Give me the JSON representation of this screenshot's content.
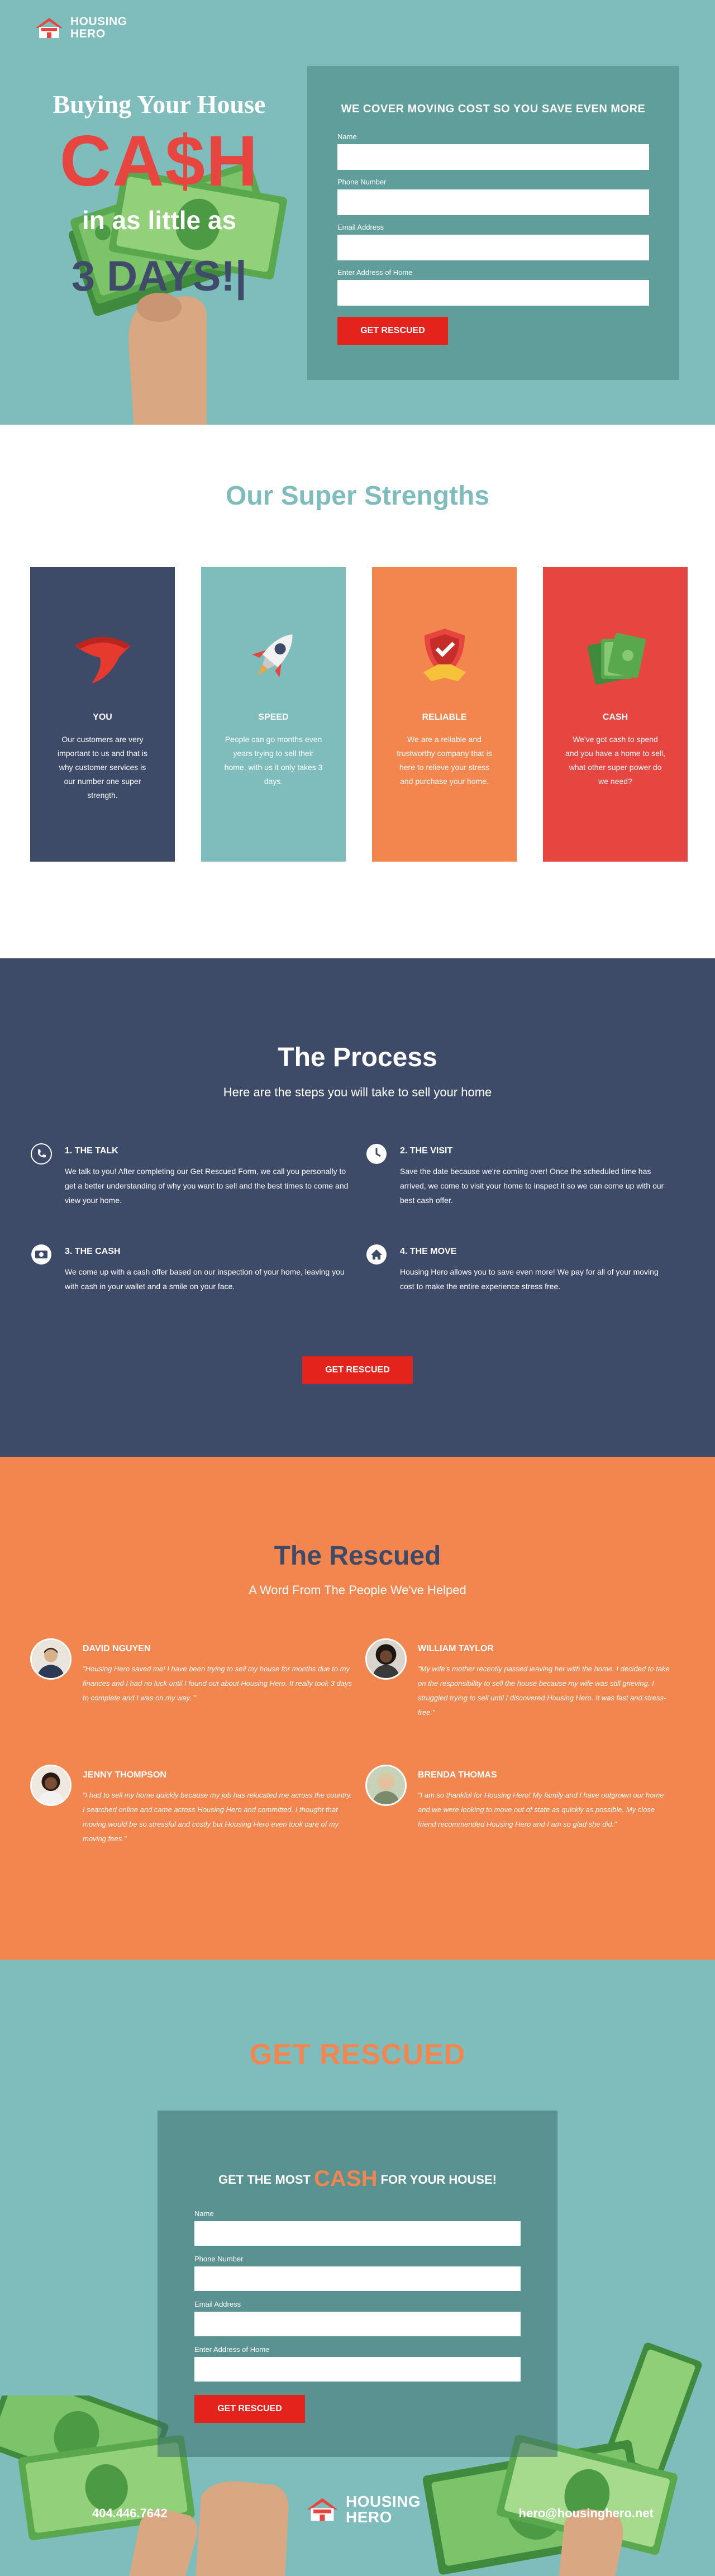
{
  "brand": {
    "line1": "HOUSING",
    "line2": "HERO"
  },
  "hero": {
    "title": "Buying Your House",
    "cash": "CA$H",
    "little": "in as little as",
    "days": "3 DAYS!|"
  },
  "hero_form": {
    "heading": "WE COVER MOVING COST SO YOU SAVE EVEN MORE",
    "name_label": "Name",
    "phone_label": "Phone Number",
    "email_label": "Email Address",
    "address_label": "Enter Address of Home",
    "submit": "GET RESCUED"
  },
  "strengths": {
    "title": "Our Super Strengths",
    "cards": [
      {
        "title": "YOU",
        "text": "Our customers are very important to us and that is why customer services is our number one super strength.",
        "color": "#3d4a68",
        "icon": "cape-icon"
      },
      {
        "title": "SPEED",
        "text": "People can go months even years trying to sell their home, with us it only takes 3 days.",
        "color": "#7ebdbc",
        "icon": "rocket-icon"
      },
      {
        "title": "RELIABLE",
        "text": "We are a reliable and trustworthy company that is here to relieve your stress and purchase your home.",
        "color": "#f3864e",
        "icon": "shield-handshake-icon"
      },
      {
        "title": "CASH",
        "text": "We've got cash to spend and you have a home to sell, what other super power do we need?",
        "color": "#e74540",
        "icon": "money-icon"
      }
    ]
  },
  "process": {
    "title": "The Process",
    "subtitle": "Here are the steps you will take to sell your home",
    "steps": [
      {
        "title": "1. THE TALK",
        "text": "We talk to you! After completing our Get Rescued Form, we call you personally to get a better understanding of why you want to sell and the best times to come and view your home.",
        "icon": "phone-icon"
      },
      {
        "title": "2. THE VISIT",
        "text": "Save the date because we're coming over! Once the scheduled time has arrived, we come to visit your home to inspect it so we can come up with our best cash offer.",
        "icon": "clock-icon"
      },
      {
        "title": "3. THE CASH",
        "text": "We come up with a cash offer based on our inspection of your home, leaving you with cash in your wallet and a smile on your face.",
        "icon": "cash-icon"
      },
      {
        "title": "4. THE MOVE",
        "text": "Housing Hero allows you to save even more! We pay for all of your moving cost to make the entire experience stress free.",
        "icon": "home-icon"
      }
    ],
    "button": "GET RESCUED"
  },
  "rescued": {
    "title": "The Rescued",
    "subtitle": "A Word From The People We've Helped",
    "testimonials": [
      {
        "name": "DAVID NGUYEN",
        "quote": "\"Housing Hero saved me! I have been trying to sell my house for months due to my finances and I had no luck until I found out about Housing Hero. It really took 3 days to complete and I was on my way. \""
      },
      {
        "name": "WILLIAM TAYLOR",
        "quote": "\"My wife's mother recently passed leaving her with the home. I decided to take on the responsibility to sell the house because my wife was still grieving. I struggled trying to sell until I discovered Housing Hero. It was fast and stress-free.\""
      },
      {
        "name": "JENNY THOMPSON",
        "quote": "\"I had to sell my home quickly because my job has relocated me across the country. I searched online and came across Housing Hero and committed. I thought that moving would be so stressful and costly but Housing Hero even took care of my moving fees.\""
      },
      {
        "name": "BRENDA THOMAS",
        "quote": "\"I am so thankful for Housing Hero! My family and I have outgrown our home and we were looking to move out of state as quickly as possible. My close friend recommended Housing Hero and I am so glad she did.\""
      }
    ]
  },
  "cta": {
    "title": "GET RESCUED",
    "heading_pre": "GET THE MOST",
    "heading_cash": "CASH",
    "heading_post": "FOR YOUR HOUSE!",
    "name_label": "Name",
    "phone_label": "Phone Number",
    "email_label": "Email Address",
    "address_label": "Enter Address of Home",
    "submit": "GET RESCUED"
  },
  "footer": {
    "phone": "404.446.7642",
    "email": "hero@housinghero.net"
  },
  "colors": {
    "teal": "#7ebdbc",
    "navy": "#3d4a68",
    "orange": "#f3864e",
    "red": "#e74540",
    "button_red": "#e4241c"
  }
}
